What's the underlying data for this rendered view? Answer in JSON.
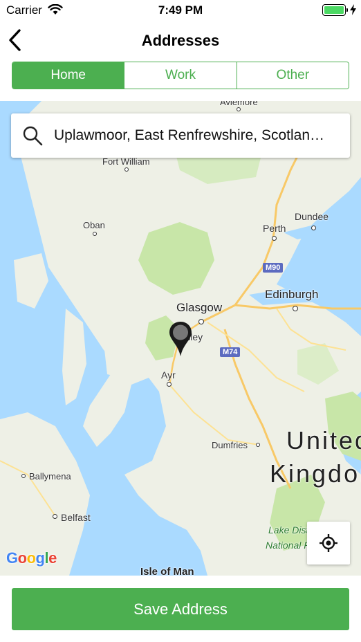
{
  "status_bar": {
    "carrier": "Carrier",
    "time": "7:49 PM",
    "battery_color": "#4cd964"
  },
  "nav": {
    "title": "Addresses",
    "back_icon": "chevron-left-icon"
  },
  "tabs": [
    {
      "label": "Home",
      "active": true
    },
    {
      "label": "Work",
      "active": false
    },
    {
      "label": "Other",
      "active": false
    }
  ],
  "search": {
    "value": "Uplawmoor, East Renfrewshire, Scotland, UK",
    "icon": "search-icon"
  },
  "map": {
    "labels": {
      "aviemore": "Aviemore",
      "fort_william": "Fort William",
      "dundee": "Dundee",
      "perth": "Perth",
      "oban": "Oban",
      "glasgow": "Glasgow",
      "edinburgh": "Edinburgh",
      "paisley": "Paisley",
      "ayr": "Ayr",
      "dumfries": "Dumfries",
      "ballymena": "Ballymena",
      "belfast": "Belfast",
      "isle_of_man": "Isle of Man",
      "country_line1": "United",
      "country_line2": "Kingdom",
      "lake_district_1": "Lake District",
      "lake_district_2": "National Park"
    },
    "roads": {
      "m90": "M90",
      "m74": "M74"
    },
    "attribution": {
      "g1": "G",
      "g2": "o",
      "g3": "o",
      "g4": "g",
      "g5": "l",
      "g6": "e"
    },
    "locate_icon": "crosshair-icon",
    "pin_icon": "map-pin-icon"
  },
  "accent_color": "#4caf50",
  "save_button": {
    "label": "Save Address"
  }
}
